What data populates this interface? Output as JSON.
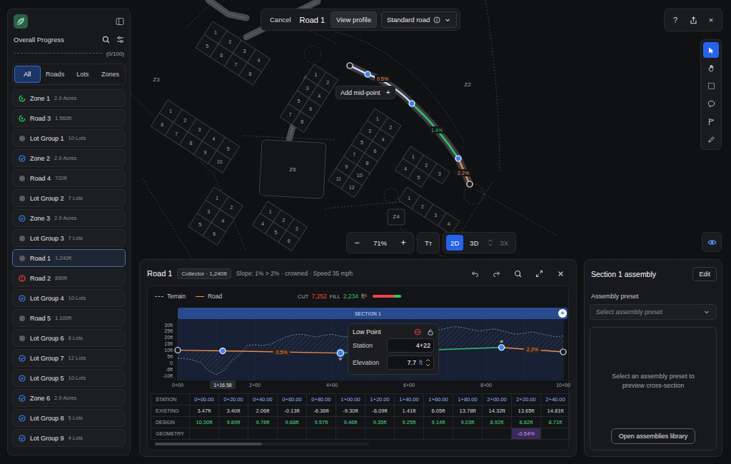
{
  "topbar": {
    "cancel": "Cancel",
    "title": "Road 1",
    "view_profile": "View profile",
    "road_type": "Standard road"
  },
  "window_controls": {
    "help": "?",
    "close": "×"
  },
  "sidebar": {
    "title": "Overall Progress",
    "progress": {
      "label": "(0/100)",
      "level": 0
    },
    "tabs": [
      {
        "label": "All",
        "selected": true
      },
      {
        "label": "Roads",
        "selected": false
      },
      {
        "label": "Lots",
        "selected": false
      },
      {
        "label": "Zones",
        "selected": false
      }
    ],
    "items": [
      {
        "name": "Zone 1",
        "meta": "2.9 Acres",
        "status": "in-progress",
        "color": "#22c55e",
        "selected": false
      },
      {
        "name": "Road 3",
        "meta": "1,560ft",
        "status": "in-progress",
        "color": "#22c55e",
        "selected": false
      },
      {
        "name": "Lot Group 1",
        "meta": "10 Lots",
        "status": "todo",
        "color": "#5b5d63",
        "selected": false
      },
      {
        "name": "Zone 2",
        "meta": "2.9 Acres",
        "status": "done",
        "color": "#3b82f6",
        "selected": false
      },
      {
        "name": "Road 4",
        "meta": "720ft",
        "status": "todo",
        "color": "#5b5d63",
        "selected": false
      },
      {
        "name": "Lot Group 2",
        "meta": "7 Lots",
        "status": "todo",
        "color": "#5b5d63",
        "selected": false
      },
      {
        "name": "Zone 3",
        "meta": "2.9 Acres",
        "status": "done",
        "color": "#3b82f6",
        "selected": false
      },
      {
        "name": "Lot Group 3",
        "meta": "7 Lots",
        "status": "todo",
        "color": "#5b5d63",
        "selected": false
      },
      {
        "name": "Road 1",
        "meta": "1,240ft",
        "status": "todo",
        "color": "#5b5d63",
        "selected": true
      },
      {
        "name": "Road 2",
        "meta": "890ft",
        "status": "error",
        "color": "#ef4444",
        "selected": false
      },
      {
        "name": "Lot Group 4",
        "meta": "10 Lots",
        "status": "done",
        "color": "#3b82f6",
        "selected": false
      },
      {
        "name": "Road 5",
        "meta": "1,100ft",
        "status": "todo",
        "color": "#5b5d63",
        "selected": false
      },
      {
        "name": "Lot Group 6",
        "meta": "8 Lots",
        "status": "todo",
        "color": "#5b5d63",
        "selected": false
      },
      {
        "name": "Lot Group 7",
        "meta": "12 Lots",
        "status": "done",
        "color": "#3b82f6",
        "selected": false
      },
      {
        "name": "Lot Group 5",
        "meta": "10 Lots",
        "status": "done",
        "color": "#3b82f6",
        "selected": false
      },
      {
        "name": "Zone 6",
        "meta": "2.9 Acres",
        "status": "done",
        "color": "#3b82f6",
        "selected": false
      },
      {
        "name": "Lot Group 8",
        "meta": "5 Lots",
        "status": "done",
        "color": "#3b82f6",
        "selected": false
      },
      {
        "name": "Lot Group 9",
        "meta": "4 Lots",
        "status": "done",
        "color": "#3b82f6",
        "selected": false
      }
    ]
  },
  "tools": [
    {
      "kind": "select",
      "selected": true
    },
    {
      "kind": "pan",
      "selected": false
    },
    {
      "kind": "marquee",
      "selected": false
    },
    {
      "kind": "comment",
      "selected": false
    },
    {
      "kind": "flag",
      "selected": false
    },
    {
      "kind": "pen",
      "selected": false
    }
  ],
  "visibility": {
    "on": true
  },
  "zoom": {
    "minus": "−",
    "value": "71%",
    "plus": "+",
    "text_tool": "Tт",
    "modes": [
      {
        "label": "2D",
        "selected": true,
        "disabled": false
      },
      {
        "label": "3D",
        "selected": false,
        "disabled": false
      },
      {
        "label": "3X",
        "selected": false,
        "disabled": true
      }
    ]
  },
  "map": {
    "zones": [
      {
        "label": "Z3"
      },
      {
        "label": "Z2"
      },
      {
        "label": "Z6"
      },
      {
        "label": "Z4"
      }
    ],
    "blocks": [
      {
        "lots": [
          "1",
          "2",
          "3",
          "4",
          "5",
          "6",
          "7",
          "8"
        ]
      },
      {
        "lots": [
          "1",
          "2",
          "3",
          "4",
          "5",
          "6",
          "7",
          "8",
          "9",
          "10"
        ]
      },
      {
        "lots": [
          "1",
          "2",
          "3",
          "4",
          "5",
          "6"
        ]
      },
      {
        "lots": [
          "1",
          "2",
          "3",
          "4",
          "5",
          "6"
        ]
      },
      {
        "lots": [
          "1",
          "2",
          "3",
          "4",
          "5",
          "6",
          "7",
          "8"
        ]
      },
      {
        "lots": [
          "1",
          "2",
          "3",
          "4",
          "5",
          "6",
          "7",
          "8",
          "9",
          "10",
          "11",
          "12"
        ]
      },
      {
        "lots": [
          "1",
          "2",
          "3",
          "4",
          "5"
        ]
      },
      {
        "lots": [
          "1",
          "2",
          "3",
          "4"
        ]
      }
    ],
    "road": {
      "points": [
        {
          "kind": "end"
        },
        {
          "kind": "pvi"
        },
        {
          "kind": "pvi"
        },
        {
          "kind": "pvi"
        },
        {
          "kind": "end"
        }
      ],
      "segments": [
        {
          "color": "#d9e4ff",
          "label": ""
        },
        {
          "color": "#d9e4ff",
          "label": "0.5%",
          "label_color": "#f08a4b"
        },
        {
          "color": "#34c26a",
          "label": "1.4%",
          "label_color": "#34c26a"
        },
        {
          "color": "#f08a4b",
          "label": "2.2%",
          "label_color": "#f08a4b"
        }
      ]
    },
    "hint": {
      "label": "Add mid-point",
      "icon": "+"
    }
  },
  "profile": {
    "title": "Road 1",
    "badge": "Collector · 1,240ft",
    "summary": "Slope: 1% > 2% · crowned · Speed 35 mph",
    "legend": [
      {
        "label": "Terrain",
        "kind": "dashed"
      },
      {
        "label": "Road",
        "kind": "solid"
      }
    ],
    "cut": {
      "label": "CUT",
      "value": "7,252"
    },
    "fill": {
      "label": "FILL",
      "value": "2,234"
    },
    "unit": "ft³",
    "cut_level": 0.76,
    "section": {
      "label": "SECTION 1",
      "add": "+"
    },
    "y_ticks": [
      "30ft",
      "25ft",
      "20ft",
      "15ft",
      "10ft",
      "5ft",
      "0",
      "-5ft",
      "-10ft"
    ],
    "x_ticks": [
      "0+00",
      "2+00",
      "4+00",
      "6+00",
      "8+00",
      "10+00"
    ],
    "cursor": {
      "station": 116.58,
      "label": "1+16.58"
    },
    "terrain_step": 20,
    "terrain": [
      3.47,
      3.4,
      2.06,
      -0.13,
      -6.36,
      -9.3,
      -6.09,
      1.41,
      6.05,
      13.78,
      14.32,
      13.65,
      14.81,
      17.5,
      20.2,
      22.0,
      22.8,
      21.5,
      20.4,
      21.8,
      22.6,
      21.0,
      20.5,
      22.4,
      24.0,
      24.8,
      25.6,
      26.1,
      25.0,
      24.2,
      26.5,
      27.8,
      28.4,
      27.2,
      26.0,
      27.5,
      28.6,
      27.8,
      26.4,
      25.1,
      26.0,
      26.8,
      25.5,
      23.8,
      22.6,
      23.5,
      24.4,
      23.0,
      21.8,
      20.6,
      21.2
    ],
    "road": {
      "stations": [
        0,
        116.58,
        422,
        840,
        1000
      ],
      "elevations": [
        10.0,
        9.42,
        7.7,
        12.1,
        8.58
      ],
      "segments": [
        {
          "color": "#f08a4b",
          "label": ""
        },
        {
          "color": "#f08a4b",
          "label": "0.5%"
        },
        {
          "color": "#34c26a",
          "label": ""
        },
        {
          "color": "#f08a4b",
          "label": "2.2%"
        }
      ]
    },
    "points": [
      {
        "kind": "end",
        "selected": false,
        "marker": "none"
      },
      {
        "kind": "pvi",
        "selected": false,
        "marker": "none"
      },
      {
        "kind": "pvi",
        "selected": true,
        "marker": "down"
      },
      {
        "kind": "pvi",
        "selected": false,
        "marker": "up"
      },
      {
        "kind": "end",
        "selected": false,
        "marker": "none"
      }
    ],
    "popup": {
      "title": "Low Point",
      "fields": [
        {
          "label": "Station",
          "value": "4+22",
          "unit": ""
        },
        {
          "label": "Elevation",
          "value": "7.7",
          "unit": "ft"
        }
      ]
    },
    "table": {
      "rows": [
        {
          "label": "STATION",
          "kind": "station",
          "cells": [
            "0+00.00",
            "0+20.00",
            "0+40.00",
            "0+60.00",
            "0+80.00",
            "1+00.00",
            "1+20.00",
            "1+40.00",
            "1+60.00",
            "1+80.00",
            "2+00.00",
            "2+20.00",
            "2+40.00"
          ]
        },
        {
          "label": "EXISTING",
          "kind": "existing",
          "cells": [
            "3.47ft",
            "3.40ft",
            "2.06ft",
            "-0.13ft",
            "-6.36ft",
            "-9.30ft",
            "-6.09ft",
            "1.41ft",
            "6.05ft",
            "13.78ft",
            "14.32ft",
            "13.65ft",
            "14.81ft"
          ]
        },
        {
          "label": "DESIGN",
          "kind": "design",
          "cells": [
            "10.00ft",
            "9.89ft",
            "9.78ft",
            "9.68ft",
            "9.57ft",
            "9.46ft",
            "9.35ft",
            "9.25ft",
            "9.14ft",
            "9.03ft",
            "8.92ft",
            "8.82ft",
            "8.71ft"
          ]
        },
        {
          "label": "GEOMETRY",
          "kind": "geometry",
          "cells": [
            "",
            "",
            "",
            "",
            "",
            "",
            "",
            "",
            "",
            "",
            "",
            "-0.54%",
            ""
          ]
        }
      ]
    }
  },
  "assembly": {
    "title": "Section 1 assembly",
    "edit": "Edit",
    "preset_label": "Assembly preset",
    "preset_placeholder": "Select assembly preset",
    "empty": "Select an assembly preset to preview cross-section",
    "library": "Open assemblies library"
  }
}
